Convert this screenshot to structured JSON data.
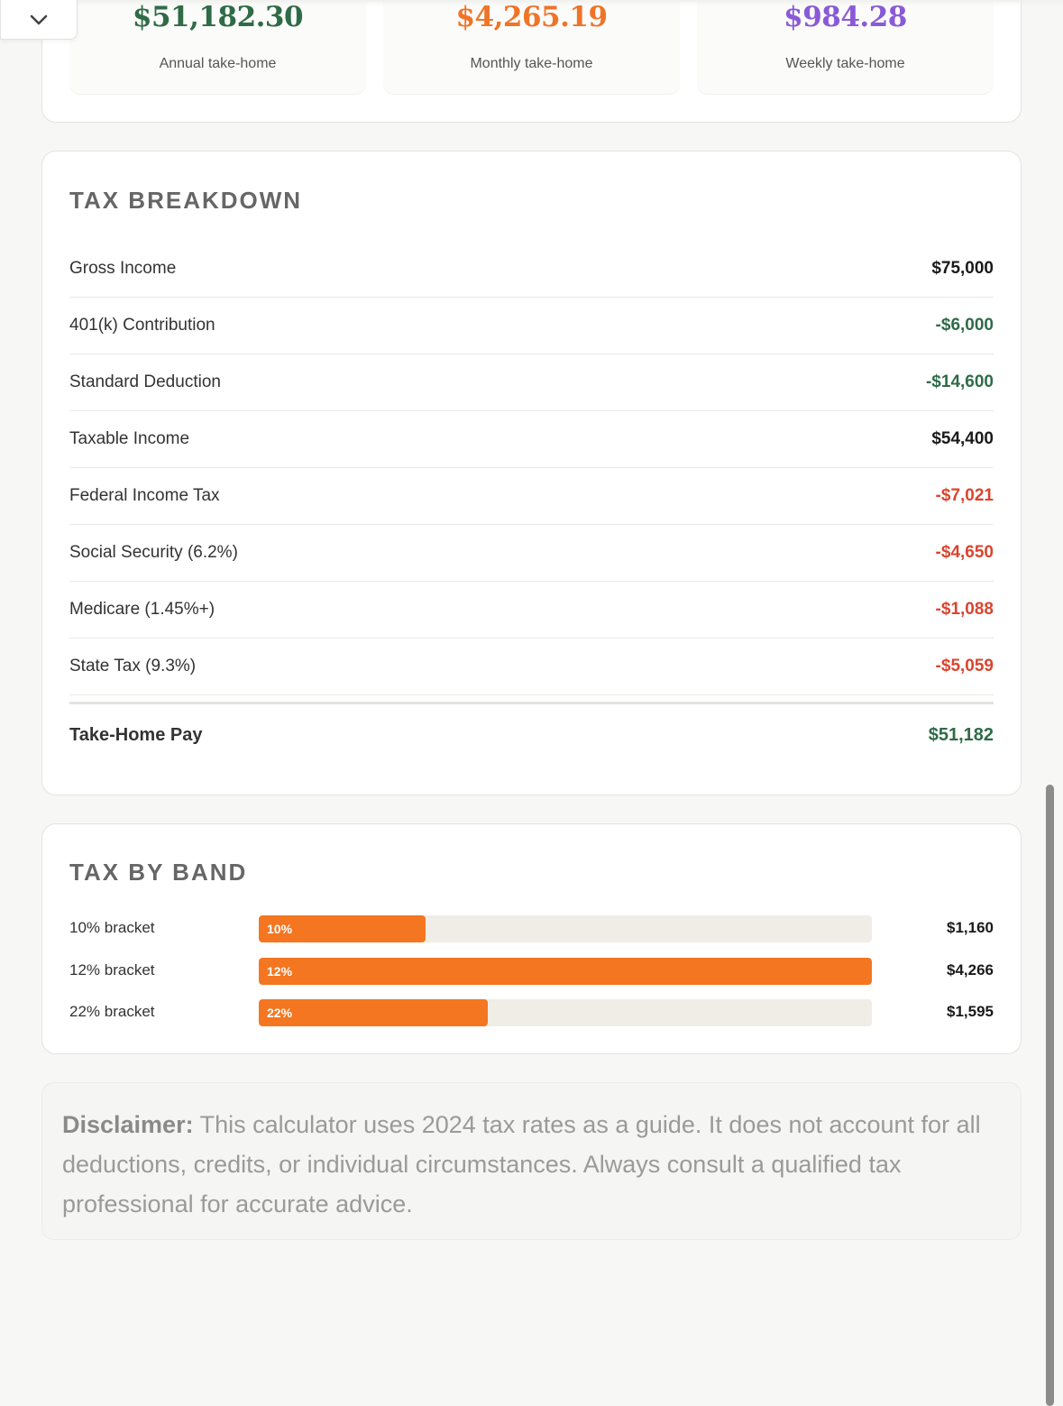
{
  "summary": {
    "annual": {
      "value": "$51,182.30",
      "label": "Annual take-home",
      "color": "#2f6b47"
    },
    "monthly": {
      "value": "$4,265.19",
      "label": "Monthly take-home",
      "color": "#f07427"
    },
    "weekly": {
      "value": "$984.28",
      "label": "Weekly take-home",
      "color": "#8a5ad6"
    }
  },
  "breakdown": {
    "title": "TAX BREAKDOWN",
    "rows": [
      {
        "label": "Gross Income",
        "value": "$75,000",
        "tone": "neutral"
      },
      {
        "label": "401(k) Contribution",
        "value": "-$6,000",
        "tone": "green"
      },
      {
        "label": "Standard Deduction",
        "value": "-$14,600",
        "tone": "green"
      },
      {
        "label": "Taxable Income",
        "value": "$54,400",
        "tone": "neutral"
      },
      {
        "label": "Federal Income Tax",
        "value": "-$7,021",
        "tone": "red"
      },
      {
        "label": "Social Security (6.2%)",
        "value": "-$4,650",
        "tone": "red"
      },
      {
        "label": "Medicare (1.45%+)",
        "value": "-$1,088",
        "tone": "red"
      },
      {
        "label": "State Tax (9.3%)",
        "value": "-$5,059",
        "tone": "red"
      }
    ],
    "total": {
      "label": "Take-Home Pay",
      "value": "$51,182"
    }
  },
  "bands": {
    "title": "TAX BY BAND",
    "items": [
      {
        "label": "10% bracket",
        "rate": "10%",
        "amount": "$1,160",
        "fill_fraction": 0.272
      },
      {
        "label": "12% bracket",
        "rate": "12%",
        "amount": "$4,266",
        "fill_fraction": 1.0
      },
      {
        "label": "22% bracket",
        "rate": "22%",
        "amount": "$1,595",
        "fill_fraction": 0.374
      }
    ]
  },
  "disclaimer": {
    "lead": "Disclaimer:",
    "text": " This calculator uses 2024 tax rates as a guide. It does not account for all deductions, credits, or individual circumstances. Always consult a qualified tax professional for accurate advice."
  },
  "icons": {
    "collapse": "chevron-down-icon"
  }
}
